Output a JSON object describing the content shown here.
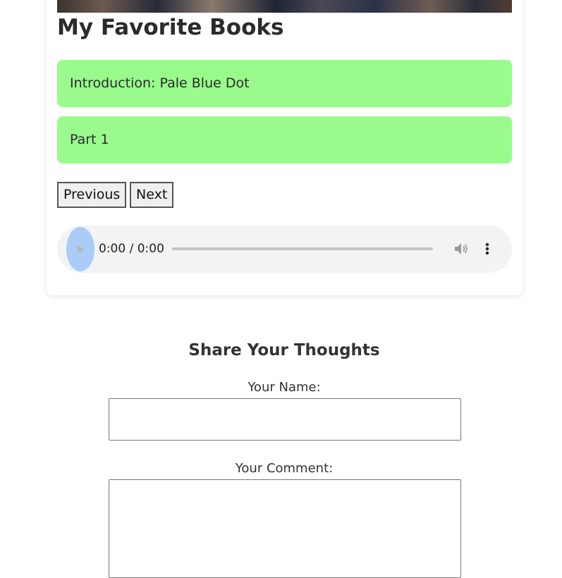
{
  "page": {
    "title": "My Favorite Books"
  },
  "chapters": [
    {
      "label": "Introduction: Pale Blue Dot"
    },
    {
      "label": "Part 1"
    }
  ],
  "navigation": {
    "previous_label": "Previous",
    "next_label": "Next"
  },
  "audio_player": {
    "time_display": "0:00 / 0:00",
    "progress": 0
  },
  "comments": {
    "heading": "Share Your Thoughts",
    "name_label": "Your Name:",
    "name_value": "",
    "comment_label": "Your Comment:",
    "comment_value": ""
  },
  "icons": {
    "play": "play-icon",
    "volume": "volume-icon",
    "more": "more-options-icon"
  },
  "colors": {
    "chapter_background": "#98fb8c",
    "play_button": "#aaccf7",
    "player_background": "#f1f3f4"
  }
}
